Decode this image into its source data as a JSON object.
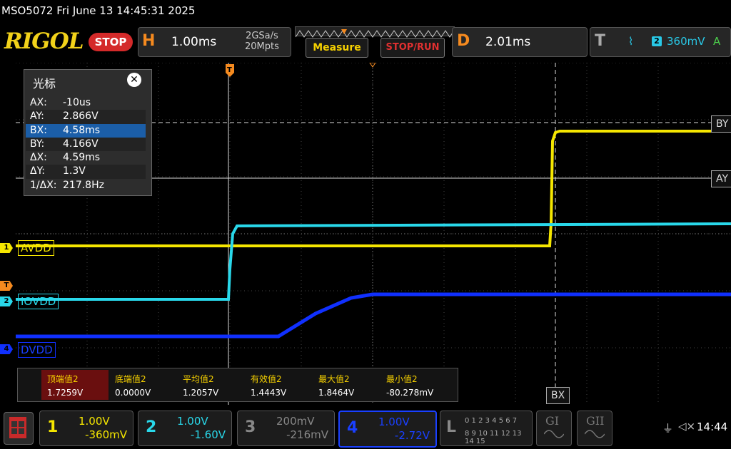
{
  "status": {
    "model_time": "MSO5072  Fri June 13 14:45:31 2025"
  },
  "brand": {
    "logo": "RIGOL",
    "run_state": "STOP"
  },
  "horizontal": {
    "letter": "H",
    "timebase": "1.00ms",
    "sample_rate": "2GSa/s",
    "memory_depth": "20Mpts"
  },
  "buttons": {
    "measure": "Measure",
    "stop_run": "STOP/RUN"
  },
  "delay": {
    "letter": "D",
    "value": "2.01ms"
  },
  "trigger": {
    "letter": "T",
    "slope_icon": "rising-edge-icon",
    "slope_glyph": "⌇",
    "channel": "2",
    "level": "360mV",
    "mode": "A"
  },
  "cursor_panel": {
    "title": "光标",
    "close_glyph": "✕",
    "rows": [
      {
        "key": "AX:",
        "value": "-10us"
      },
      {
        "key": "AY:",
        "value": "2.866V"
      },
      {
        "key": "BX:",
        "value": "4.58ms"
      },
      {
        "key": "BY:",
        "value": "4.166V"
      },
      {
        "key": "ΔX:",
        "value": "4.59ms"
      },
      {
        "key": "ΔY:",
        "value": "1.3V"
      },
      {
        "key": "1/ΔX:",
        "value": "217.8Hz"
      }
    ],
    "selected_row": 2
  },
  "channels_on_screen": {
    "ch1": {
      "num": "1",
      "label": "AVDD",
      "color": "#f5e600"
    },
    "ch2": {
      "num": "2",
      "label": "IOVDD",
      "color": "#29d8ea"
    },
    "ch4": {
      "num": "4",
      "label": "DVDD",
      "color": "#1030ff"
    },
    "trigger_marker": "T"
  },
  "cursor_labels": {
    "by": "BY",
    "ay": "AY",
    "bx": "BX"
  },
  "measurements": [
    {
      "name": "顶端值2",
      "value": "1.7259V"
    },
    {
      "name": "底端值2",
      "value": "0.0000V"
    },
    {
      "name": "平均值2",
      "value": "1.2057V"
    },
    {
      "name": "有效值2",
      "value": "1.4443V"
    },
    {
      "name": "最大值2",
      "value": "1.8464V"
    },
    {
      "name": "最小值2",
      "value": "-80.278mV"
    }
  ],
  "bottom": {
    "ch1": {
      "num": "1",
      "scale": "1.00V",
      "offset": "-360mV",
      "color": "#f5e600"
    },
    "ch2": {
      "num": "2",
      "scale": "1.00V",
      "offset": "-1.60V",
      "color": "#29d8ea"
    },
    "ch3": {
      "num": "3",
      "scale": "200mV",
      "offset": "-216mV",
      "color": "#888888"
    },
    "ch4": {
      "num": "4",
      "scale": "1.00V",
      "offset": "-2.72V",
      "color": "#1a40ff"
    },
    "la": {
      "letter": "L",
      "row1": "0 1 2 3   4 5 6 7",
      "row2": "8 9 10 11 12 13 14 15"
    },
    "g1": "GI",
    "g2": "GII",
    "time": "14:44"
  },
  "colors": {
    "background": "#000000",
    "grid": "#555555",
    "accent_orange": "#f58a1f",
    "selected": "#1b5ea8"
  }
}
